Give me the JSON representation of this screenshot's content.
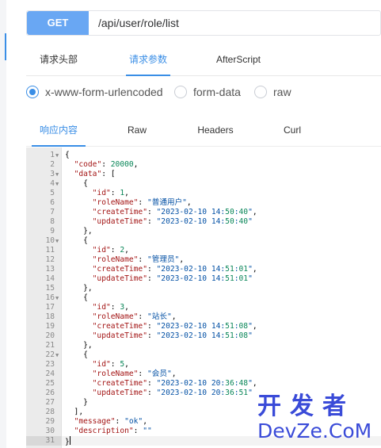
{
  "request": {
    "method": "GET",
    "url": "/api/user/role/list"
  },
  "request_tabs": [
    {
      "label": "请求头部",
      "active": false
    },
    {
      "label": "请求参数",
      "active": true
    },
    {
      "label": "AfterScript",
      "active": false
    }
  ],
  "body_types": [
    {
      "label": "x-www-form-urlencoded",
      "checked": true
    },
    {
      "label": "form-data",
      "checked": false
    },
    {
      "label": "raw",
      "checked": false
    }
  ],
  "response_tabs": [
    {
      "label": "响应内容",
      "active": true
    },
    {
      "label": "Raw",
      "active": false
    },
    {
      "label": "Headers",
      "active": false
    },
    {
      "label": "Curl",
      "active": false
    }
  ],
  "response_lines": [
    {
      "n": "1",
      "fold": true,
      "text": "{"
    },
    {
      "n": "2",
      "fold": false,
      "text": "  \"code\": 20000,"
    },
    {
      "n": "3",
      "fold": true,
      "text": "  \"data\": ["
    },
    {
      "n": "4",
      "fold": true,
      "text": "    {"
    },
    {
      "n": "5",
      "fold": false,
      "text": "      \"id\": 1,"
    },
    {
      "n": "6",
      "fold": false,
      "text": "      \"roleName\": \"普通用户\","
    },
    {
      "n": "7",
      "fold": false,
      "text": "      \"createTime\": \"2023-02-10 14:50:40\","
    },
    {
      "n": "8",
      "fold": false,
      "text": "      \"updateTime\": \"2023-02-10 14:50:40\""
    },
    {
      "n": "9",
      "fold": false,
      "text": "    },"
    },
    {
      "n": "10",
      "fold": true,
      "text": "    {"
    },
    {
      "n": "11",
      "fold": false,
      "text": "      \"id\": 2,"
    },
    {
      "n": "12",
      "fold": false,
      "text": "      \"roleName\": \"管理员\","
    },
    {
      "n": "13",
      "fold": false,
      "text": "      \"createTime\": \"2023-02-10 14:51:01\","
    },
    {
      "n": "14",
      "fold": false,
      "text": "      \"updateTime\": \"2023-02-10 14:51:01\""
    },
    {
      "n": "15",
      "fold": false,
      "text": "    },"
    },
    {
      "n": "16",
      "fold": true,
      "text": "    {"
    },
    {
      "n": "17",
      "fold": false,
      "text": "      \"id\": 3,"
    },
    {
      "n": "18",
      "fold": false,
      "text": "      \"roleName\": \"站长\","
    },
    {
      "n": "19",
      "fold": false,
      "text": "      \"createTime\": \"2023-02-10 14:51:08\","
    },
    {
      "n": "20",
      "fold": false,
      "text": "      \"updateTime\": \"2023-02-10 14:51:08\""
    },
    {
      "n": "21",
      "fold": false,
      "text": "    },"
    },
    {
      "n": "22",
      "fold": true,
      "text": "    {"
    },
    {
      "n": "23",
      "fold": false,
      "text": "      \"id\": 5,"
    },
    {
      "n": "24",
      "fold": false,
      "text": "      \"roleName\": \"会员\","
    },
    {
      "n": "25",
      "fold": false,
      "text": "      \"createTime\": \"2023-02-10 20:36:48\","
    },
    {
      "n": "26",
      "fold": false,
      "text": "      \"updateTime\": \"2023-02-10 20:36:51\""
    },
    {
      "n": "27",
      "fold": false,
      "text": "    }"
    },
    {
      "n": "28",
      "fold": false,
      "text": "  ],"
    },
    {
      "n": "29",
      "fold": false,
      "text": "  \"message\": \"ok\","
    },
    {
      "n": "30",
      "fold": false,
      "text": "  \"description\": \"\""
    },
    {
      "n": "31",
      "fold": false,
      "text": "}",
      "current": true
    }
  ],
  "watermark": {
    "line1": "开发者",
    "line2": "DevZe.CoM"
  },
  "colors": {
    "accent": "#3a8ee6",
    "method_bg": "#69a7f3",
    "json_key": "#a31515",
    "json_string": "#0451a5",
    "json_number": "#098658",
    "watermark": "#3a4bd8"
  }
}
